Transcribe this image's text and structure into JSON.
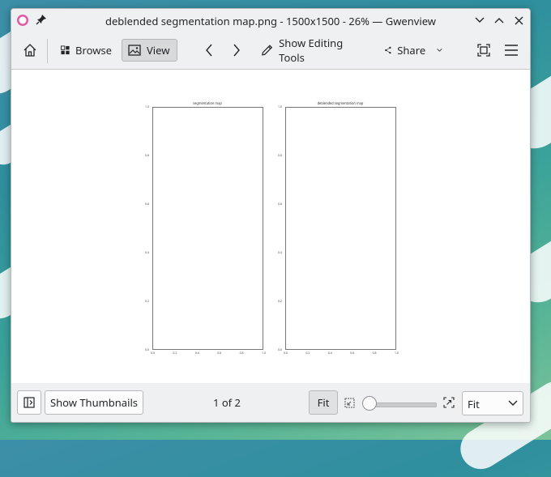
{
  "window": {
    "title": "deblended segmentation map.png - 1500x1500 - 26% — Gwenview"
  },
  "toolbar": {
    "browse_label": "Browse",
    "view_label": "View",
    "editing_label": "Show Editing Tools",
    "share_label": "Share"
  },
  "image": {
    "left_plot": {
      "title": "segmentation map",
      "y_ticks": [
        "1.0",
        "0.8",
        "0.6",
        "0.4",
        "0.2",
        "0.0"
      ],
      "x_ticks": [
        "0.0",
        "0.2",
        "0.4",
        "0.6",
        "0.8",
        "1.0"
      ]
    },
    "right_plot": {
      "title": "deblended segmentation map",
      "y_ticks": [
        "1.0",
        "0.8",
        "0.6",
        "0.4",
        "0.2",
        "0.0"
      ],
      "x_ticks": [
        "0.0",
        "0.2",
        "0.4",
        "0.6",
        "0.8",
        "1.0"
      ]
    }
  },
  "bottombar": {
    "thumbnails_label": "Show Thumbnails",
    "pager_text": "1 of 2",
    "fit_button_label": "Fit",
    "zoom_combo_value": "Fit",
    "zoom_slider_value": 0.0
  },
  "colors": {
    "window_bg": "#eff0f1",
    "active_button_bg": "#d7d9db",
    "viewer_bg": "#ffffff"
  }
}
